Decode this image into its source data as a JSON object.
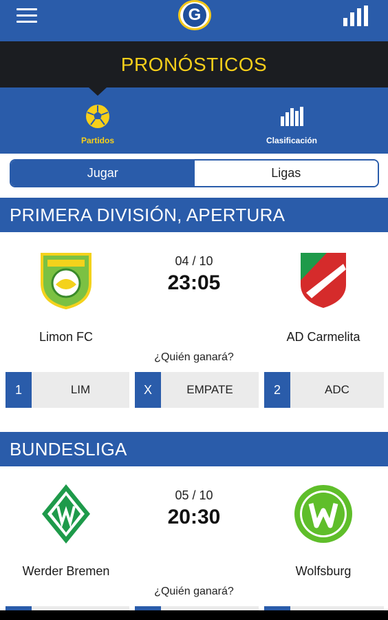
{
  "header": {
    "logo_letter": "G"
  },
  "title": "PRONÓSTICOS",
  "tabs": [
    {
      "label": "Partidos",
      "icon": "soccer-ball-icon"
    },
    {
      "label": "Clasificación",
      "icon": "bar-chart-icon"
    }
  ],
  "segments": [
    {
      "label": "Jugar"
    },
    {
      "label": "Ligas"
    }
  ],
  "colors": {
    "primary": "#2a5caa",
    "accent": "#f7cf1a",
    "dark": "#1b1d21",
    "option_bg": "#ebebeb"
  },
  "leagues": [
    {
      "name": "PRIMERA DIVISIÓN, APERTURA",
      "match": {
        "home": {
          "name": "Limon FC",
          "badge": "limon-fc-crest"
        },
        "away": {
          "name": "AD Carmelita",
          "badge": "ad-carmelita-crest"
        },
        "date": "04 / 10",
        "time": "23:05",
        "question": "¿Quién ganará?",
        "options": [
          {
            "num": "1",
            "label": "LIM"
          },
          {
            "num": "X",
            "label": "EMPATE"
          },
          {
            "num": "2",
            "label": "ADC"
          }
        ]
      }
    },
    {
      "name": "BUNDESLIGA",
      "match": {
        "home": {
          "name": "Werder Bremen",
          "badge": "werder-bremen-crest"
        },
        "away": {
          "name": "Wolfsburg",
          "badge": "wolfsburg-crest"
        },
        "date": "05 / 10",
        "time": "20:30",
        "question": "¿Quién ganará?"
      }
    }
  ]
}
